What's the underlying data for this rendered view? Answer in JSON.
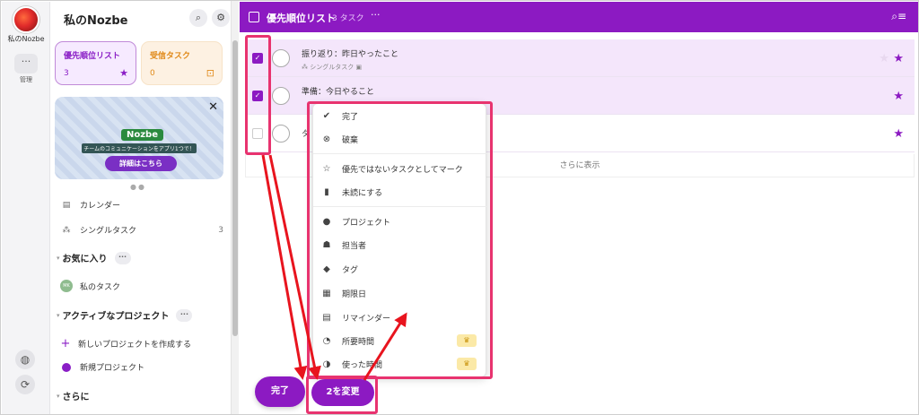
{
  "rail": {
    "workspace_name": "私のNozbe",
    "manage_label": "管理",
    "more_glyph": "···"
  },
  "sidebar": {
    "title": "私のNozbe",
    "cards": [
      {
        "label": "優先順位リスト",
        "count": "3",
        "color": "#8a1ec6"
      },
      {
        "label": "受信タスク",
        "count": "0",
        "color": "#e08a1a"
      }
    ],
    "promo": {
      "logo": "Nozbe",
      "subtitle": "チームのコミュニケーションをアプリ1つで！",
      "button": "詳細はこちら"
    },
    "nav": [
      {
        "label": "カレンダー",
        "count": ""
      },
      {
        "label": "シングルタスク",
        "count": "3"
      }
    ],
    "favorites": {
      "label": "お気に入り",
      "more": "···",
      "items": [
        {
          "initials": "MK",
          "label": "私のタスク"
        }
      ]
    },
    "active_projects": {
      "label": "アクティブなプロジェクト",
      "more": "···",
      "create": "新しいプロジェクトを作成する",
      "items": [
        {
          "label": "新規プロジェクト"
        }
      ]
    },
    "more_section": "さらに"
  },
  "topbar": {
    "title": "優先順位リスト",
    "count": "3 タスク",
    "more": "···"
  },
  "tasks": [
    {
      "title": "振り返り：昨日やったこと",
      "sub": "シングルタスク",
      "checked": true
    },
    {
      "title": "準備：今日やること",
      "sub": "",
      "checked": true
    },
    {
      "title": "タ",
      "sub": "",
      "checked": false
    }
  ],
  "show_more": "さらに表示",
  "menu": {
    "items": [
      {
        "label": "完了",
        "icon": "check-circle-icon",
        "premium": false
      },
      {
        "label": "破棄",
        "icon": "x-circle-icon",
        "premium": false
      },
      {
        "label": "優先ではないタスクとしてマーク",
        "icon": "star-outline-icon",
        "premium": false
      },
      {
        "label": "未読にする",
        "icon": "bookmark-icon",
        "premium": false
      },
      {
        "label": "プロジェクト",
        "icon": "dot-icon",
        "premium": false
      },
      {
        "label": "担当者",
        "icon": "person-icon",
        "premium": false
      },
      {
        "label": "タグ",
        "icon": "tag-icon",
        "premium": false
      },
      {
        "label": "期限日",
        "icon": "calendar-icon",
        "premium": false
      },
      {
        "label": "リマインダー",
        "icon": "reminder-icon",
        "premium": false
      },
      {
        "label": "所要時間",
        "icon": "clock-icon",
        "premium": true
      },
      {
        "label": "使った時間",
        "icon": "time-spent-icon",
        "premium": true
      }
    ]
  },
  "buttons": {
    "done": "完了",
    "change": "2を変更"
  },
  "colors": {
    "accent": "#8c1ac2",
    "highlight": "#e8336f"
  }
}
